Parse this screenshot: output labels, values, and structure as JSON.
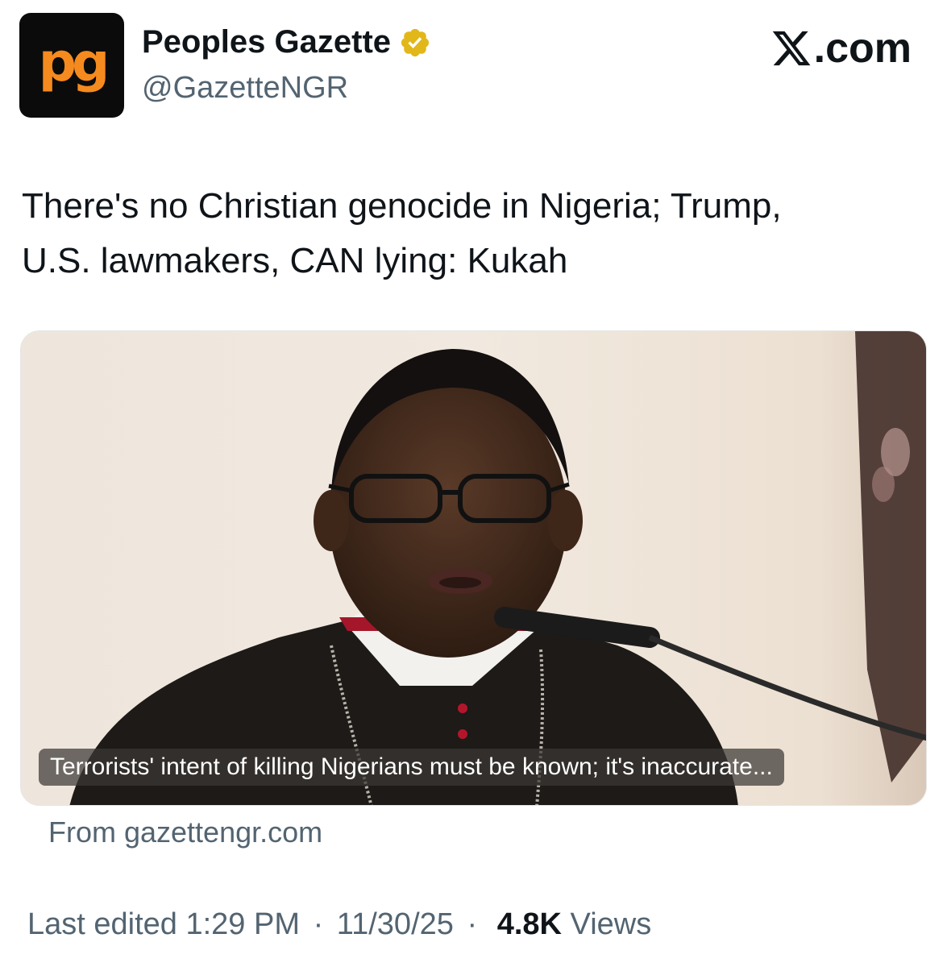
{
  "account": {
    "avatar_text": "pg",
    "display_name": "Peoples Gazette",
    "handle": "@GazetteNGR",
    "verified_color": "#e2b719"
  },
  "brand": {
    "label": ".com"
  },
  "tweet": {
    "text_line1": "There's no Christian genocide in Nigeria; Trump,",
    "text_line2": "U.S. lawmakers, CAN lying: Kukah"
  },
  "card": {
    "caption": "Terrorists' intent of killing Nigerians must be known; it's inaccurate...",
    "source": "From gazettengr.com"
  },
  "meta": {
    "edited_label": "Last edited",
    "time": "1:29 PM",
    "date": "11/30/25",
    "views_count": "4.8K",
    "views_label": "Views",
    "separator": "·"
  },
  "colors": {
    "text_primary": "#0f1419",
    "text_secondary": "#536471",
    "avatar_bg": "#0b0b0b",
    "avatar_fg": "#f58a1f"
  }
}
